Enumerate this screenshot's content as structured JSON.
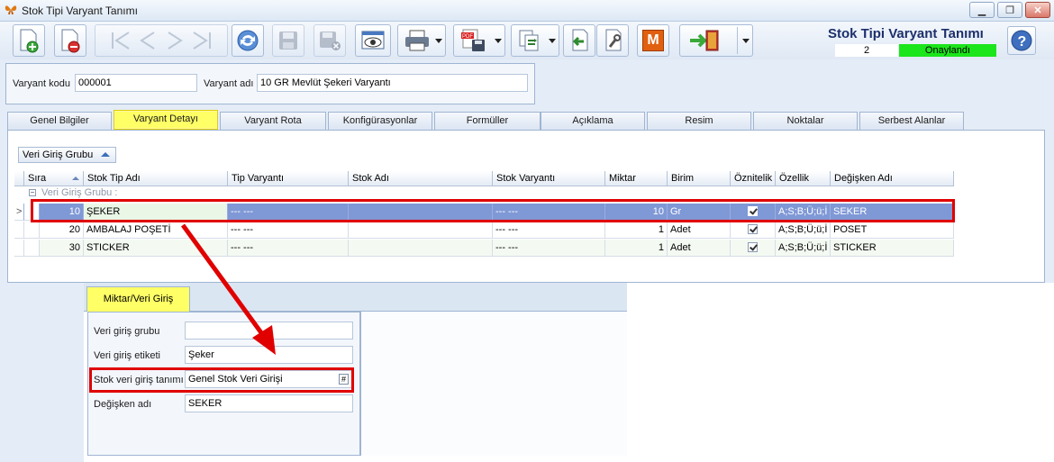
{
  "window": {
    "title": "Stok Tipi Varyant Tanımı",
    "controls": [
      "minimize",
      "restore",
      "close"
    ]
  },
  "toolbar": {
    "icons": [
      "new-icon",
      "delete-icon",
      "first-icon",
      "previous-icon",
      "next-icon",
      "last-icon",
      "refresh-icon",
      "save-icon",
      "save-close-icon",
      "preview-icon",
      "print-icon",
      "pdf-export-icon",
      "copy-icon",
      "import-icon",
      "tools-icon",
      "m-icon",
      "exit-icon"
    ],
    "m_label": "M"
  },
  "header": {
    "title": "Stok Tipi Varyant Tanımı",
    "number": "2",
    "status": "Onaylandı",
    "status_color": "#1be51b"
  },
  "variant": {
    "code_label": "Varyant kodu",
    "code_value": "000001",
    "name_label": "Varyant adı",
    "name_value": "10 GR Mevlüt Şekeri Varyantı"
  },
  "tabs": [
    {
      "label": "Genel Bilgiler"
    },
    {
      "label": "Varyant Detayı",
      "active": true
    },
    {
      "label": "Varyant Rota"
    },
    {
      "label": "Konfigürasyonlar"
    },
    {
      "label": "Formüller"
    },
    {
      "label": "Açıklama"
    },
    {
      "label": "Resim"
    },
    {
      "label": "Noktalar"
    },
    {
      "label": "Serbest Alanlar"
    }
  ],
  "group_button": {
    "label": "Veri Giriş Grubu"
  },
  "grid": {
    "columns": [
      "Sıra",
      "Stok Tip Adı",
      "Tip Varyantı",
      "Stok Adı",
      "Stok Varyantı",
      "Miktar",
      "Birim",
      "Öznitelik",
      "Özellik",
      "Değişken Adı"
    ],
    "group_label": "Veri Giriş Grubu :",
    "rows": [
      {
        "sira": "10",
        "stok_tip_adi": "ŞEKER",
        "tip_varyanti": "--- ---",
        "stok_adi": "",
        "stok_varyanti": "--- ---",
        "miktar": "10",
        "birim": "Gr",
        "oznitelik": true,
        "ozellik": "A;S;B;Ü;ü;İ",
        "degisken_adi": "SEKER",
        "selected": true
      },
      {
        "sira": "20",
        "stok_tip_adi": "AMBALAJ POŞETİ",
        "tip_varyanti": "--- ---",
        "stok_adi": "",
        "stok_varyanti": "--- ---",
        "miktar": "1",
        "birim": "Adet",
        "oznitelik": true,
        "ozellik": "A;S;B;Ü;ü;İ",
        "degisken_adi": "POSET"
      },
      {
        "sira": "30",
        "stok_tip_adi": "STICKER",
        "tip_varyanti": "--- ---",
        "stok_adi": "",
        "stok_varyanti": "--- ---",
        "miktar": "1",
        "birim": "Adet",
        "oznitelik": true,
        "ozellik": "A;S;B;Ü;ü;İ",
        "degisken_adi": "STICKER"
      }
    ]
  },
  "detail": {
    "tab_label": "Miktar/Veri Giriş",
    "fields": [
      {
        "label": "Veri giriş grubu",
        "value": ""
      },
      {
        "label": "Veri giriş etiketi",
        "value": "Şeker"
      },
      {
        "label": "Stok veri giriş tanımı",
        "value": "Genel Stok Veri Girişi",
        "button": "#"
      },
      {
        "label": "Değişken adı",
        "value": "SEKER"
      }
    ]
  },
  "colors": {
    "highlight": "#e00000",
    "active_tab": "#ffff66",
    "selected_row": "#7f98d6"
  }
}
